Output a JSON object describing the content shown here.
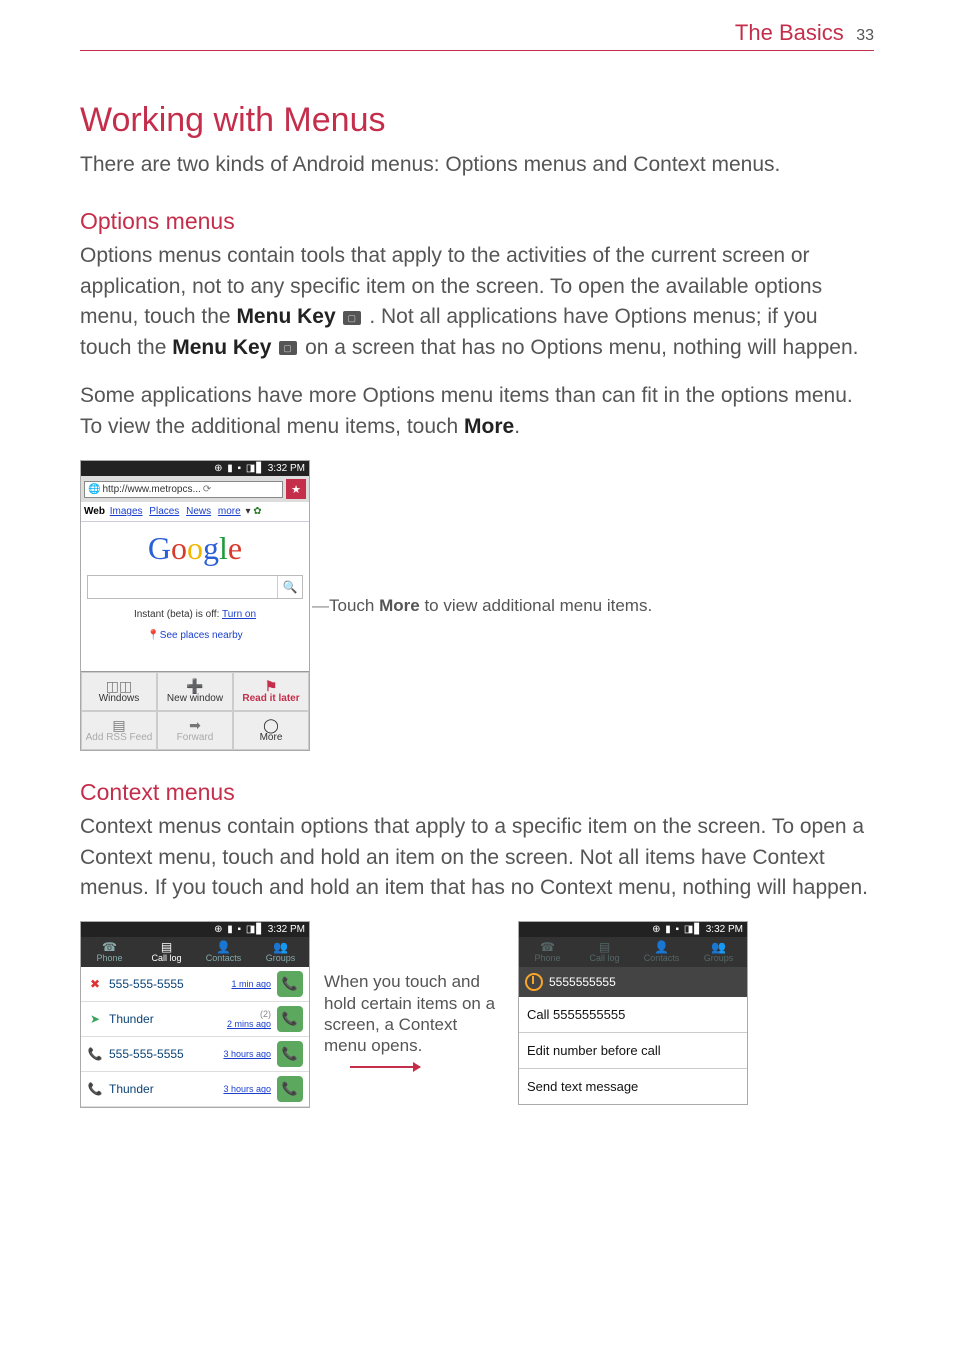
{
  "header": {
    "section": "The Basics",
    "page": "33"
  },
  "h1": "Working with Menus",
  "intro": "There are two kinds of Android menus: Options menus and Context menus.",
  "options": {
    "heading": "Options menus",
    "p1a": "Options menus contain tools that apply to the activities of the current screen or application, not to any specific item on the screen. To open the available options menu, touch the ",
    "keyLabel1": "Menu Key",
    "p1b": ". Not all applications have Options menus; if you touch the ",
    "keyLabel2": "Menu Key",
    "p1c": " on a screen that has no Options menu, nothing will happen.",
    "p2a": "Some applications have more Options menu items than can fit in the options menu. To view the additional menu items, touch ",
    "more": "More",
    "p2b": "."
  },
  "browserShot": {
    "time": "3:32 PM",
    "url": "http://www.metropcs...",
    "tabs": {
      "web": "Web",
      "images": "Images",
      "places": "Places",
      "news": "News",
      "more": "more"
    },
    "instant_prefix": "Instant (beta) is off: ",
    "instant_link": "Turn on",
    "places_nearby": "See places nearby",
    "menu": {
      "windows": "Windows",
      "newwindow": "New window",
      "readit": "Read it later",
      "addrss": "Add RSS Feed",
      "forward": "Forward",
      "more": "More"
    }
  },
  "callout1a": "Touch ",
  "callout1b": "More",
  "callout1c": " to view additional menu items.",
  "context": {
    "heading": "Context menus",
    "p": "Context menus contain options that apply to a specific item on the screen. To open a Context menu, touch and hold an item on the screen. Not all items have Context menus. If you touch and hold an item that has no Context menu, nothing will happen."
  },
  "callLog": {
    "time": "3:32 PM",
    "tabs": {
      "phone": "Phone",
      "calllog": "Call log",
      "contacts": "Contacts",
      "groups": "Groups"
    },
    "rows": [
      {
        "name": "555-555-5555",
        "sub": "1 min ago",
        "count": ""
      },
      {
        "name": "Thunder",
        "sub": "2 mins ago",
        "count": "(2)"
      },
      {
        "name": "555-555-5555",
        "sub": "3 hours ago",
        "count": ""
      },
      {
        "name": "Thunder",
        "sub": "3 hours ago",
        "count": ""
      }
    ]
  },
  "middleNote": "When you touch and hold certain items on a screen, a Context menu opens.",
  "contextMenuShot": {
    "time": "3:32 PM",
    "tabs": {
      "phone": "Phone",
      "calllog": "Call log",
      "contacts": "Contacts",
      "groups": "Groups"
    },
    "headerNumber": "5555555555",
    "items": [
      "Call 5555555555",
      "Edit number before call",
      "Send text message"
    ]
  }
}
